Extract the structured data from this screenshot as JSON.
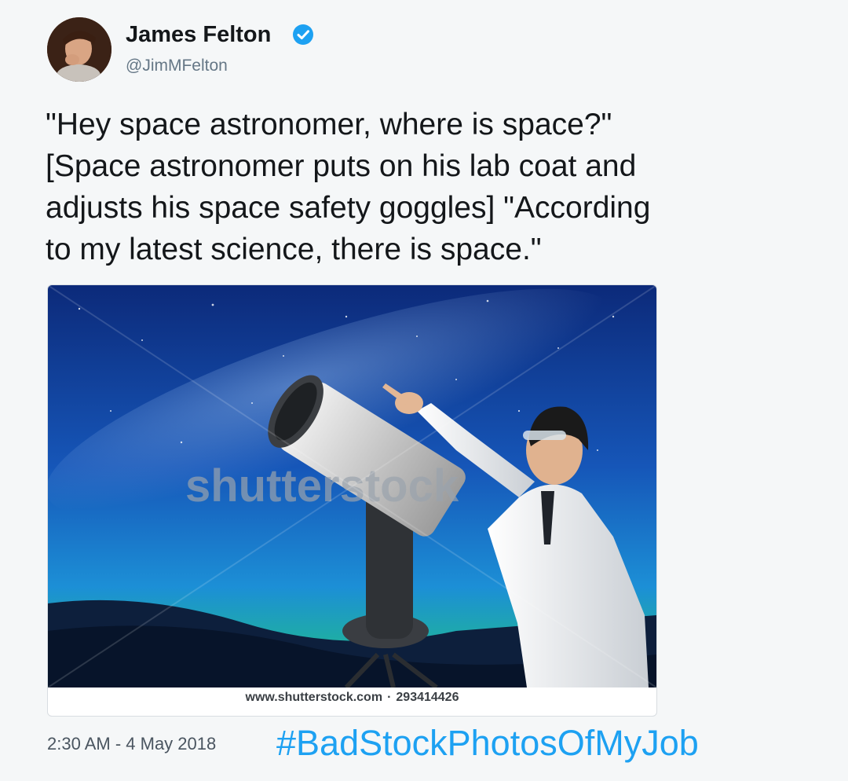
{
  "tweet": {
    "author_name": "James Felton",
    "handle": "@JimMFelton",
    "verified_icon": "verified-badge-icon",
    "text": "\"Hey space astronomer, where is space?\"\n[Space astronomer puts on his lab coat and\nadjusts his space safety goggles] \"According\nto my latest science, there is space.\"",
    "timestamp": "2:30 AM - 4 May 2018"
  },
  "media": {
    "watermark": "shutterstock",
    "caption_url": "www.shutterstock.com",
    "caption_separator": "·",
    "caption_id": "293414426"
  },
  "hashtag": "#BadStockPhotosOfMyJob",
  "colors": {
    "text": "#14171a",
    "muted": "#657786",
    "link": "#1da1f2",
    "verified": "#1da1f2"
  }
}
